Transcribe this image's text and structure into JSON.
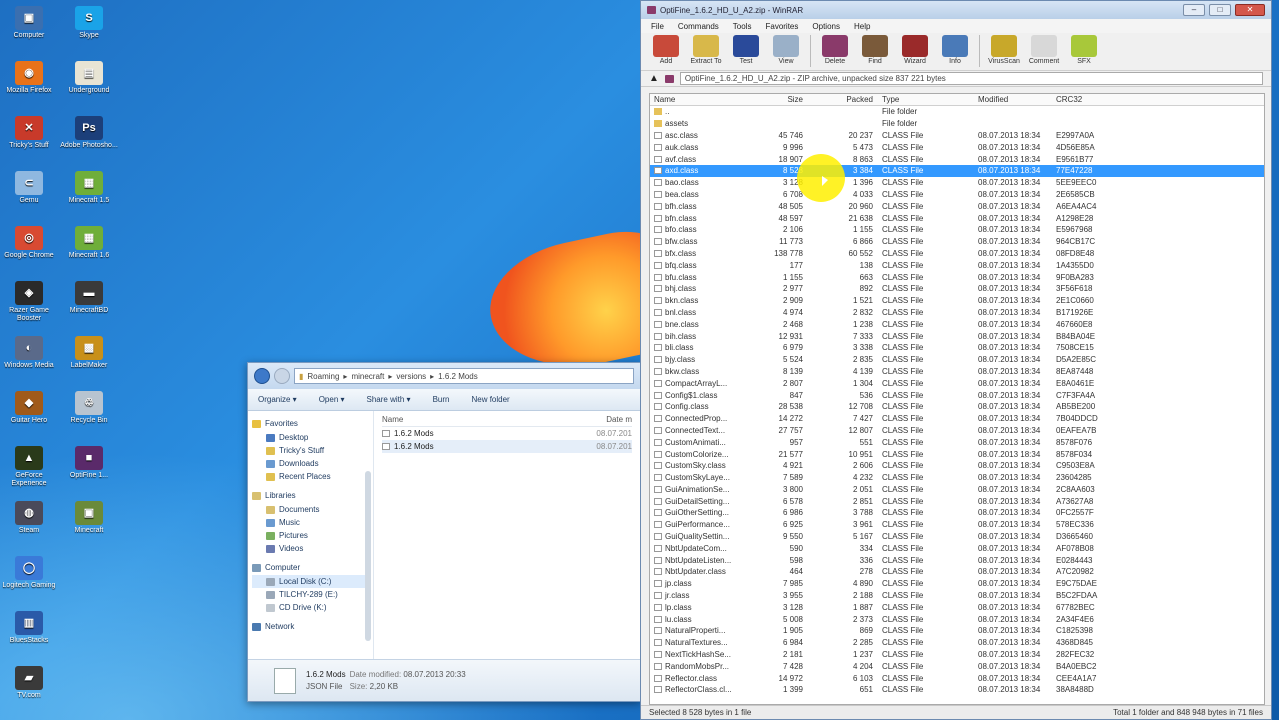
{
  "desktop": {
    "icons": [
      {
        "label": "Computer",
        "color": "#3a6fb0",
        "glyph": "▣",
        "col": 0,
        "row": 0
      },
      {
        "label": "Skype",
        "color": "#1aa3e8",
        "glyph": "S",
        "col": 1,
        "row": 0
      },
      {
        "label": "Mozilla Firefox",
        "color": "#e8721a",
        "glyph": "◉",
        "col": 0,
        "row": 1
      },
      {
        "label": "Underground",
        "color": "#e8e4d4",
        "glyph": "▤",
        "col": 1,
        "row": 1
      },
      {
        "label": "Tricky's Stuff",
        "color": "#c83a2a",
        "glyph": "✕",
        "col": 0,
        "row": 2
      },
      {
        "label": "Adobe Photosho...",
        "color": "#1c3f7a",
        "glyph": "Ps",
        "col": 1,
        "row": 2
      },
      {
        "label": "Gemu",
        "color": "#8fb8e0",
        "glyph": "⊂",
        "col": 0,
        "row": 3
      },
      {
        "label": "Minecraft 1.5",
        "color": "#6fae3a",
        "glyph": "▦",
        "col": 1,
        "row": 3
      },
      {
        "label": "Google Chrome",
        "color": "#d84a32",
        "glyph": "◎",
        "col": 0,
        "row": 4
      },
      {
        "label": "Minecraft 1.6",
        "color": "#6fae3a",
        "glyph": "▦",
        "col": 1,
        "row": 4
      },
      {
        "label": "Razer Game Booster",
        "color": "#2a2a2a",
        "glyph": "◈",
        "col": 0,
        "row": 5
      },
      {
        "label": "MinecraftBD",
        "color": "#3a3a3a",
        "glyph": "▬",
        "col": 1,
        "row": 5
      },
      {
        "label": "Windows Media",
        "color": "#5a6a8a",
        "glyph": "◐",
        "col": 0,
        "row": 6
      },
      {
        "label": "LabelMaker",
        "color": "#c8901a",
        "glyph": "▩",
        "col": 1,
        "row": 6
      },
      {
        "label": "Guitar Hero",
        "color": "#a05a1a",
        "glyph": "◆",
        "col": 0,
        "row": 7
      },
      {
        "label": "Recycle Bin",
        "color": "#b8c4d0",
        "glyph": "♲",
        "col": 1,
        "row": 7
      },
      {
        "label": "GeForce Experience",
        "color": "#2a3a1a",
        "glyph": "▲",
        "col": 0,
        "row": 8
      },
      {
        "label": "OptiFine 1...",
        "color": "#5a2a6a",
        "glyph": "■",
        "col": 1,
        "row": 8
      },
      {
        "label": "Steam",
        "color": "#4a4a5a",
        "glyph": "◍",
        "col": 0,
        "row": 9
      },
      {
        "label": "Minecraft",
        "color": "#6a8a3a",
        "glyph": "▣",
        "col": 1,
        "row": 9
      },
      {
        "label": "Logitech Gaming",
        "color": "#3a7ad8",
        "glyph": "◯",
        "col": 0,
        "row": 10
      },
      {
        "label": "BluesStacks",
        "color": "#2a5aa8",
        "glyph": "▥",
        "col": 0,
        "row": 11
      },
      {
        "label": "TV.com",
        "color": "#3a3a3a",
        "glyph": "▰",
        "col": 0,
        "row": 12
      }
    ]
  },
  "explorer": {
    "path": [
      "Roaming",
      "minecraft",
      "versions",
      "1.6.2 Mods"
    ],
    "toolbar": [
      "Organize ▾",
      "Open ▾",
      "Share with ▾",
      "Burn",
      "New folder"
    ],
    "nav": {
      "favorites": {
        "title": "Favorites",
        "items": [
          "Desktop",
          "Tricky's Stuff",
          "Downloads",
          "Recent Places"
        ]
      },
      "libraries": {
        "title": "Libraries",
        "items": [
          "Documents",
          "Music",
          "Pictures",
          "Videos"
        ]
      },
      "computer": {
        "title": "Computer",
        "items": [
          "Local Disk (C:)",
          "TILCHY-289 (E:)",
          "CD Drive (K:)"
        ]
      },
      "network": "Network"
    },
    "list_header": {
      "name": "Name",
      "date": "Date m"
    },
    "files": [
      {
        "name": "1.6.2 Mods",
        "date": "08.07.201"
      },
      {
        "name": "1.6.2 Mods",
        "date": "08.07.201"
      }
    ],
    "status": {
      "name": "1.6.2 Mods",
      "type": "JSON File",
      "date_label": "Date modified:",
      "date_value": "08.07.2013 20:33",
      "size_label": "Size:",
      "size_value": "2,20 KB"
    }
  },
  "winrar": {
    "title": "OptiFine_1.6.2_HD_U_A2.zip - WinRAR",
    "menu": [
      "File",
      "Commands",
      "Tools",
      "Favorites",
      "Options",
      "Help"
    ],
    "toolbar": [
      {
        "label": "Add",
        "color": "#c84a3a"
      },
      {
        "label": "Extract To",
        "color": "#d8b84a"
      },
      {
        "label": "Test",
        "color": "#2a4a9a"
      },
      {
        "label": "View",
        "color": "#9ab0c8"
      },
      {
        "label": "Delete",
        "color": "#8a3a6a"
      },
      {
        "label": "Find",
        "color": "#7a5a3a"
      },
      {
        "label": "Wizard",
        "color": "#9a2a2a"
      },
      {
        "label": "Info",
        "color": "#4a7ab8"
      },
      {
        "label": "VirusScan",
        "color": "#c8a82a"
      },
      {
        "label": "Comment",
        "color": "#d8d8d8"
      },
      {
        "label": "SFX",
        "color": "#a8c83a"
      }
    ],
    "path": "OptiFine_1.6.2_HD_U_A2.zip - ZIP archive, unpacked size 837 221 bytes",
    "columns": [
      "Name",
      "Size",
      "Packed",
      "Type",
      "Modified",
      "CRC32"
    ],
    "rows": [
      {
        "name": "..",
        "size": "",
        "packed": "",
        "type": "File folder",
        "modified": "",
        "crc": "",
        "kind": "folder"
      },
      {
        "name": "assets",
        "size": "",
        "packed": "",
        "type": "File folder",
        "modified": "",
        "crc": "",
        "kind": "folder"
      },
      {
        "name": "asc.class",
        "size": "45 746",
        "packed": "20 237",
        "type": "CLASS File",
        "modified": "08.07.2013 18:34",
        "crc": "E2997A0A",
        "kind": "file"
      },
      {
        "name": "auk.class",
        "size": "9 996",
        "packed": "5 473",
        "type": "CLASS File",
        "modified": "08.07.2013 18:34",
        "crc": "4D56E85A",
        "kind": "file"
      },
      {
        "name": "avf.class",
        "size": "18 907",
        "packed": "8 863",
        "type": "CLASS File",
        "modified": "08.07.2013 18:34",
        "crc": "E9561B77",
        "kind": "file"
      },
      {
        "name": "axd.class",
        "size": "8 528",
        "packed": "3 384",
        "type": "CLASS File",
        "modified": "08.07.2013 18:34",
        "crc": "77E47228",
        "kind": "file",
        "selected": true
      },
      {
        "name": "bao.class",
        "size": "3 128",
        "packed": "1 396",
        "type": "CLASS File",
        "modified": "08.07.2013 18:34",
        "crc": "5EE9EEC0",
        "kind": "file"
      },
      {
        "name": "bea.class",
        "size": "6 708",
        "packed": "4 033",
        "type": "CLASS File",
        "modified": "08.07.2013 18:34",
        "crc": "2E6585CB",
        "kind": "file"
      },
      {
        "name": "bfh.class",
        "size": "48 505",
        "packed": "20 960",
        "type": "CLASS File",
        "modified": "08.07.2013 18:34",
        "crc": "A6EA4AC4",
        "kind": "file"
      },
      {
        "name": "bfn.class",
        "size": "48 597",
        "packed": "21 638",
        "type": "CLASS File",
        "modified": "08.07.2013 18:34",
        "crc": "A1298E28",
        "kind": "file"
      },
      {
        "name": "bfo.class",
        "size": "2 106",
        "packed": "1 155",
        "type": "CLASS File",
        "modified": "08.07.2013 18:34",
        "crc": "E5967968",
        "kind": "file"
      },
      {
        "name": "bfw.class",
        "size": "11 773",
        "packed": "6 866",
        "type": "CLASS File",
        "modified": "08.07.2013 18:34",
        "crc": "964CB17C",
        "kind": "file"
      },
      {
        "name": "bfx.class",
        "size": "138 778",
        "packed": "60 552",
        "type": "CLASS File",
        "modified": "08.07.2013 18:34",
        "crc": "08FD8E48",
        "kind": "file"
      },
      {
        "name": "bfq.class",
        "size": "177",
        "packed": "138",
        "type": "CLASS File",
        "modified": "08.07.2013 18:34",
        "crc": "1A4355D0",
        "kind": "file"
      },
      {
        "name": "bfu.class",
        "size": "1 155",
        "packed": "663",
        "type": "CLASS File",
        "modified": "08.07.2013 18:34",
        "crc": "9F0BA283",
        "kind": "file"
      },
      {
        "name": "bhj.class",
        "size": "2 977",
        "packed": "892",
        "type": "CLASS File",
        "modified": "08.07.2013 18:34",
        "crc": "3F56F618",
        "kind": "file"
      },
      {
        "name": "bkn.class",
        "size": "2 909",
        "packed": "1 521",
        "type": "CLASS File",
        "modified": "08.07.2013 18:34",
        "crc": "2E1C0660",
        "kind": "file"
      },
      {
        "name": "bnl.class",
        "size": "4 974",
        "packed": "2 832",
        "type": "CLASS File",
        "modified": "08.07.2013 18:34",
        "crc": "B171926E",
        "kind": "file"
      },
      {
        "name": "bne.class",
        "size": "2 468",
        "packed": "1 238",
        "type": "CLASS File",
        "modified": "08.07.2013 18:34",
        "crc": "467660E8",
        "kind": "file"
      },
      {
        "name": "bih.class",
        "size": "12 931",
        "packed": "7 333",
        "type": "CLASS File",
        "modified": "08.07.2013 18:34",
        "crc": "B84BA04E",
        "kind": "file"
      },
      {
        "name": "bli.class",
        "size": "6 979",
        "packed": "3 338",
        "type": "CLASS File",
        "modified": "08.07.2013 18:34",
        "crc": "7508CE15",
        "kind": "file"
      },
      {
        "name": "bjy.class",
        "size": "5 524",
        "packed": "2 835",
        "type": "CLASS File",
        "modified": "08.07.2013 18:34",
        "crc": "D5A2E85C",
        "kind": "file"
      },
      {
        "name": "bkw.class",
        "size": "8 139",
        "packed": "4 139",
        "type": "CLASS File",
        "modified": "08.07.2013 18:34",
        "crc": "8EA87448",
        "kind": "file"
      },
      {
        "name": "CompactArrayL...",
        "size": "2 807",
        "packed": "1 304",
        "type": "CLASS File",
        "modified": "08.07.2013 18:34",
        "crc": "E8A0461E",
        "kind": "file"
      },
      {
        "name": "Config$1.class",
        "size": "847",
        "packed": "536",
        "type": "CLASS File",
        "modified": "08.07.2013 18:34",
        "crc": "C7F3FA4A",
        "kind": "file"
      },
      {
        "name": "Config.class",
        "size": "28 538",
        "packed": "12 708",
        "type": "CLASS File",
        "modified": "08.07.2013 18:34",
        "crc": "AB5BE200",
        "kind": "file"
      },
      {
        "name": "ConnectedProp...",
        "size": "14 272",
        "packed": "7 427",
        "type": "CLASS File",
        "modified": "08.07.2013 18:34",
        "crc": "7B04DDCD",
        "kind": "file"
      },
      {
        "name": "ConnectedText...",
        "size": "27 757",
        "packed": "12 807",
        "type": "CLASS File",
        "modified": "08.07.2013 18:34",
        "crc": "0EAFEA7B",
        "kind": "file"
      },
      {
        "name": "CustomAnimati...",
        "size": "957",
        "packed": "551",
        "type": "CLASS File",
        "modified": "08.07.2013 18:34",
        "crc": "8578F076",
        "kind": "file"
      },
      {
        "name": "CustomColorize...",
        "size": "21 577",
        "packed": "10 951",
        "type": "CLASS File",
        "modified": "08.07.2013 18:34",
        "crc": "8578F034",
        "kind": "file"
      },
      {
        "name": "CustomSky.class",
        "size": "4 921",
        "packed": "2 606",
        "type": "CLASS File",
        "modified": "08.07.2013 18:34",
        "crc": "C9503E8A",
        "kind": "file"
      },
      {
        "name": "CustomSkyLaye...",
        "size": "7 589",
        "packed": "4 232",
        "type": "CLASS File",
        "modified": "08.07.2013 18:34",
        "crc": "23604285",
        "kind": "file"
      },
      {
        "name": "GuiAnimationSe...",
        "size": "3 800",
        "packed": "2 051",
        "type": "CLASS File",
        "modified": "08.07.2013 18:34",
        "crc": "2C8AA603",
        "kind": "file"
      },
      {
        "name": "GuiDetailSetting...",
        "size": "6 578",
        "packed": "2 851",
        "type": "CLASS File",
        "modified": "08.07.2013 18:34",
        "crc": "A73627A8",
        "kind": "file"
      },
      {
        "name": "GuiOtherSetting...",
        "size": "6 986",
        "packed": "3 788",
        "type": "CLASS File",
        "modified": "08.07.2013 18:34",
        "crc": "0FC2557F",
        "kind": "file"
      },
      {
        "name": "GuiPerformance...",
        "size": "6 925",
        "packed": "3 961",
        "type": "CLASS File",
        "modified": "08.07.2013 18:34",
        "crc": "578EC336",
        "kind": "file"
      },
      {
        "name": "GuiQualitySettin...",
        "size": "9 550",
        "packed": "5 167",
        "type": "CLASS File",
        "modified": "08.07.2013 18:34",
        "crc": "D3665460",
        "kind": "file"
      },
      {
        "name": "NbtUpdateCom...",
        "size": "590",
        "packed": "334",
        "type": "CLASS File",
        "modified": "08.07.2013 18:34",
        "crc": "AF078B08",
        "kind": "file"
      },
      {
        "name": "NbtUpdateListen...",
        "size": "598",
        "packed": "336",
        "type": "CLASS File",
        "modified": "08.07.2013 18:34",
        "crc": "E0284443",
        "kind": "file"
      },
      {
        "name": "NbtUpdater.class",
        "size": "464",
        "packed": "278",
        "type": "CLASS File",
        "modified": "08.07.2013 18:34",
        "crc": "A7C20982",
        "kind": "file"
      },
      {
        "name": "jp.class",
        "size": "7 985",
        "packed": "4 890",
        "type": "CLASS File",
        "modified": "08.07.2013 18:34",
        "crc": "E9C75DAE",
        "kind": "file"
      },
      {
        "name": "jr.class",
        "size": "3 955",
        "packed": "2 188",
        "type": "CLASS File",
        "modified": "08.07.2013 18:34",
        "crc": "B5C2FDAA",
        "kind": "file"
      },
      {
        "name": "lp.class",
        "size": "3 128",
        "packed": "1 887",
        "type": "CLASS File",
        "modified": "08.07.2013 18:34",
        "crc": "67782BEC",
        "kind": "file"
      },
      {
        "name": "lu.class",
        "size": "5 008",
        "packed": "2 373",
        "type": "CLASS File",
        "modified": "08.07.2013 18:34",
        "crc": "2A34F4E6",
        "kind": "file"
      },
      {
        "name": "NaturalProperti...",
        "size": "1 905",
        "packed": "869",
        "type": "CLASS File",
        "modified": "08.07.2013 18:34",
        "crc": "C1825398",
        "kind": "file"
      },
      {
        "name": "NaturalTextures...",
        "size": "6 984",
        "packed": "2 285",
        "type": "CLASS File",
        "modified": "08.07.2013 18:34",
        "crc": "4368D845",
        "kind": "file"
      },
      {
        "name": "NextTickHashSe...",
        "size": "2 181",
        "packed": "1 237",
        "type": "CLASS File",
        "modified": "08.07.2013 18:34",
        "crc": "282FEC32",
        "kind": "file"
      },
      {
        "name": "RandomMobsPr...",
        "size": "7 428",
        "packed": "4 204",
        "type": "CLASS File",
        "modified": "08.07.2013 18:34",
        "crc": "B4A0EBC2",
        "kind": "file"
      },
      {
        "name": "Reflector.class",
        "size": "14 972",
        "packed": "6 103",
        "type": "CLASS File",
        "modified": "08.07.2013 18:34",
        "crc": "CEE4A1A7",
        "kind": "file"
      },
      {
        "name": "ReflectorClass.cl...",
        "size": "1 399",
        "packed": "651",
        "type": "CLASS File",
        "modified": "08.07.2013 18:34",
        "crc": "38A8488D",
        "kind": "file"
      }
    ],
    "status_left": "Selected 8 528 bytes in 1 file",
    "status_right": "Total 1 folder and 848 948 bytes in 71 files"
  }
}
